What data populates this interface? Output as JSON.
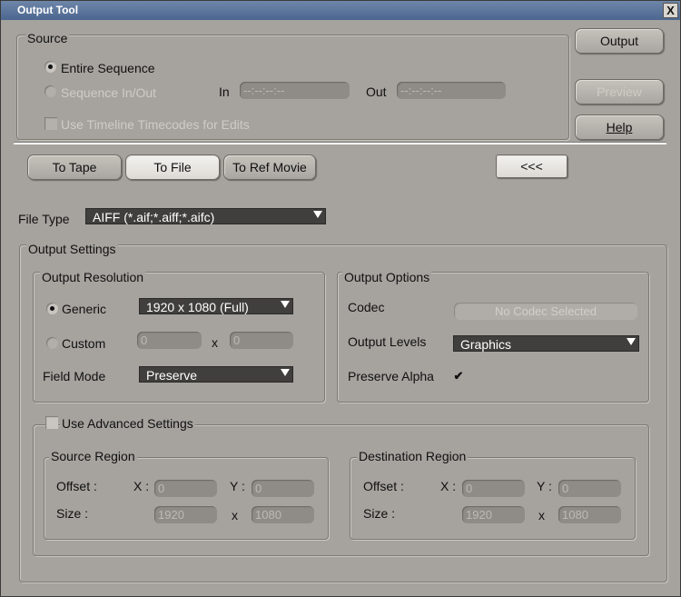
{
  "window": {
    "title": "Output Tool",
    "close_glyph": "X"
  },
  "source": {
    "legend": "Source",
    "entire_sequence": "Entire Sequence",
    "sequence_in_out": "Sequence In/Out",
    "in_label": "In",
    "in_value": "--:--:--:--",
    "out_label": "Out",
    "out_value": "--:--:--:--",
    "use_timeline": "Use Timeline Timecodes for Edits"
  },
  "buttons": {
    "output": "Output",
    "preview": "Preview",
    "help": "Help",
    "back": "<<<"
  },
  "tabs": [
    {
      "label": "To Tape",
      "active": false
    },
    {
      "label": "To File",
      "active": true
    },
    {
      "label": "To Ref Movie",
      "active": false
    }
  ],
  "file_type": {
    "label": "File Type",
    "value": "AIFF (*.aif;*.aiff;*.aifc)"
  },
  "output_settings": {
    "legend": "Output Settings",
    "resolution": {
      "legend": "Output Resolution",
      "generic": "Generic",
      "generic_value": "1920 x 1080 (Full)",
      "custom": "Custom",
      "custom_w": "0",
      "x": "x",
      "custom_h": "0",
      "field_mode_label": "Field Mode",
      "field_mode_value": "Preserve"
    },
    "options": {
      "legend": "Output Options",
      "codec_label": "Codec",
      "codec_value": "No Codec Selected",
      "levels_label": "Output Levels",
      "levels_value": "Graphics",
      "alpha_label": "Preserve Alpha",
      "alpha_checked": "✔"
    },
    "advanced": {
      "label": "Use Advanced Settings",
      "source_region": {
        "legend": "Source Region",
        "offset_label": "Offset :",
        "x_label": "X :",
        "x_value": "0",
        "y_label": "Y :",
        "y_value": "0",
        "size_label": "Size :",
        "w_value": "1920",
        "x_sep": "x",
        "h_value": "1080"
      },
      "destination_region": {
        "legend": "Destination Region",
        "offset_label": "Offset :",
        "x_label": "X :",
        "x_value": "0",
        "y_label": "Y :",
        "y_value": "0",
        "size_label": "Size :",
        "w_value": "1920",
        "x_sep": "x",
        "h_value": "1080"
      }
    }
  }
}
